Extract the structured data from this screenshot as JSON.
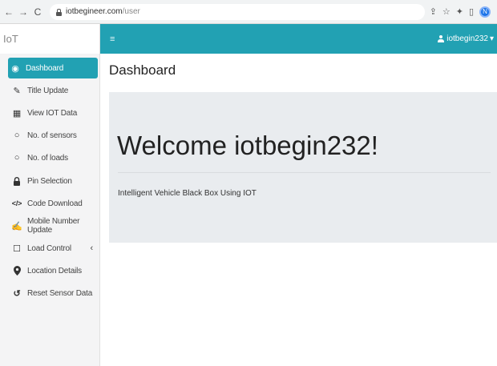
{
  "browser": {
    "url_domain": "iotbegineer.com",
    "url_path": "/user",
    "profile_initial": "N",
    "back": "←",
    "forward": "→",
    "reload": "C",
    "icons": [
      "share-icon",
      "star-icon",
      "extensions-icon",
      "sidebar-icon"
    ],
    "icon_glyphs": [
      "⇪",
      "☆",
      "✦",
      "▯"
    ]
  },
  "brand": {
    "name": "IoT"
  },
  "topbar": {
    "menu_glyph": "≡",
    "username": "iotbegin232",
    "dropdown_glyph": "▾"
  },
  "sidebar": {
    "items": [
      {
        "label": "Dashboard",
        "icon": "dashboard-icon",
        "glyph": "◉",
        "active": true
      },
      {
        "label": "Title Update",
        "icon": "edit-icon",
        "glyph": "✎"
      },
      {
        "label": "View IOT Data",
        "icon": "table-icon",
        "glyph": "▦"
      },
      {
        "label": "No. of sensors",
        "icon": "circle-icon",
        "glyph": "○"
      },
      {
        "label": "No. of loads",
        "icon": "circle-icon",
        "glyph": "○"
      },
      {
        "label": "Pin Selection",
        "icon": "lock-icon",
        "glyph": "🔒"
      },
      {
        "label": "Code Download",
        "icon": "code-icon",
        "glyph": "</>"
      },
      {
        "label": "Mobile Number Update",
        "icon": "edit-square-icon",
        "glyph": "✍"
      },
      {
        "label": "Load Control",
        "icon": "square-icon",
        "glyph": "☐",
        "chevron": "‹"
      },
      {
        "label": "Location Details",
        "icon": "map-marker-icon",
        "glyph": "⚲"
      },
      {
        "label": "Reset Sensor Data",
        "icon": "undo-icon",
        "glyph": "↺"
      }
    ]
  },
  "main": {
    "title": "Dashboard",
    "welcome": "Welcome iotbegin232!",
    "subtitle": "Intelligent Vehicle Black Box Using IOT"
  },
  "colors": {
    "accent": "#22a1b3",
    "sidebar_bg": "#f4f4f5",
    "jumbotron_bg": "#e9ecef"
  }
}
